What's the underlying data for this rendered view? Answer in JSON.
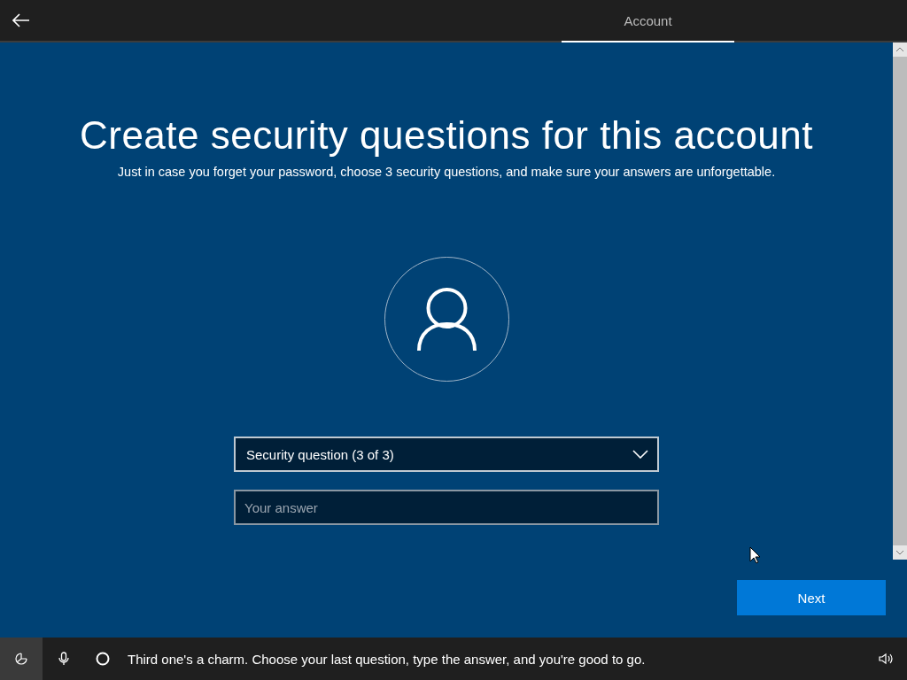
{
  "top_bar": {
    "tabs": [
      {
        "label": "Account",
        "selected": true
      }
    ]
  },
  "page": {
    "title": "Create security questions for this account",
    "subtitle": "Just in case you forget your password, choose 3 security questions, and make sure your answers are unforgettable.",
    "question_dropdown": {
      "value": "Security question (3 of 3)"
    },
    "answer_field": {
      "placeholder": "Your answer"
    },
    "next_button": {
      "label": "Next"
    }
  },
  "assistant_bar": {
    "message": "Third one's a charm. Choose your last question, type the answer, and you're good to go."
  }
}
